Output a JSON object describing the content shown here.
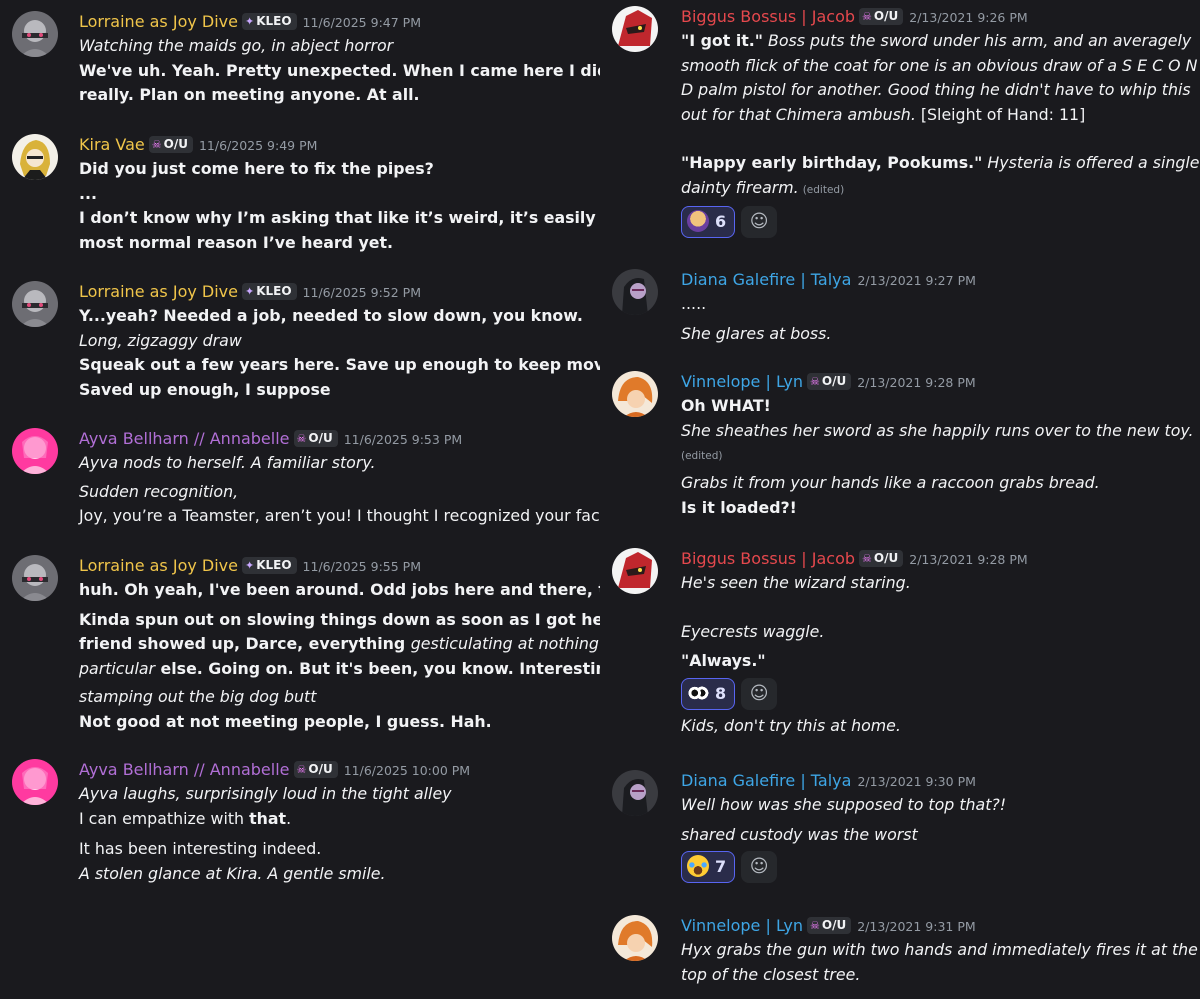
{
  "left": {
    "messages": [
      {
        "user": "Lorraine as Joy Dive",
        "color": "#f0c54a",
        "tag": "KLEO",
        "time": "11/6/2025 9:47 PM",
        "lines": [
          {
            "t": "Watching the maids go, in abject horror"
          },
          {
            "t": "We've uh. Yeah. Pretty unexpected. When I came here I didn't"
          },
          {
            "t": "really. Plan on meeting anyone. At all."
          }
        ]
      },
      {
        "user": "Kira Vae",
        "color": "#f0c54a",
        "tag": "O/U",
        "time": "11/6/2025 9:49 PM",
        "lines": [
          {
            "t": "Did you just come here to fix the pipes?"
          },
          {
            "t": "..."
          },
          {
            "t": "I don’t know why I’m asking that like it’s weird, it’s easily the"
          },
          {
            "t": "most normal reason I’ve heard yet."
          }
        ]
      },
      {
        "user": "Lorraine as Joy Dive",
        "color": "#f0c54a",
        "tag": "KLEO",
        "time": "11/6/2025 9:52 PM",
        "lines": [
          {
            "t": "Y...yeah? Needed a job, needed to slow down, you know."
          },
          {
            "t": "Long, zigzaggy draw"
          },
          {
            "t": "Squeak out a few years here. Save up enough to keep movin."
          },
          {
            "t": "Saved up enough, I suppose"
          }
        ]
      },
      {
        "user": "Ayva Bellharn // Annabelle",
        "color": "#b16fd6",
        "tag": "O/U",
        "time": "11/6/2025 9:53 PM",
        "lines": [
          {
            "t": "Ayva nods to herself. A familiar story."
          },
          {
            "t": "Sudden recognition,"
          },
          {
            "t": "Joy, you’re a Teamster, aren’t you! I thought I recognized your face."
          }
        ]
      },
      {
        "user": "Lorraine as Joy Dive",
        "color": "#f0c54a",
        "tag": "KLEO",
        "time": "11/6/2025 9:55 PM",
        "lines": [
          {
            "t": "huh. Oh yeah, I've been around. Odd jobs here and there, too"
          },
          {
            "t": "Kinda spun out on slowing things down as soon as I got here. Old"
          },
          {
            "t": "friend showed up, Darce, everything"
          },
          {
            "t": "gesticulating at nothing in"
          },
          {
            "t": "particular"
          },
          {
            "t": "else. Going on. But it's been, you know. Interesting"
          },
          {
            "t": "stamping out the big dog butt"
          },
          {
            "t": "Not good at not meeting people, I guess. Hah."
          }
        ]
      },
      {
        "user": "Ayva Bellharn // Annabelle",
        "color": "#b16fd6",
        "tag": "O/U",
        "time": "11/6/2025 10:00 PM",
        "lines": [
          {
            "t": "Ayva laughs, surprisingly loud in the tight alley"
          },
          {
            "t": "I can empathize with "
          },
          {
            "t": "that"
          },
          {
            "t": "."
          },
          {
            "t": "It has been interesting indeed."
          },
          {
            "t": "A stolen glance at Kira. A gentle smile."
          }
        ]
      }
    ]
  },
  "right": {
    "messages": [
      {
        "user": "Biggus Bossus | Jacob",
        "color": "#e5484d",
        "tag": "O/U",
        "time": "2/13/2021 9:26 PM",
        "lines": [
          {
            "t": "\"I got it.\""
          },
          {
            "t": " Boss puts the sword under his arm, and an averagely"
          },
          {
            "t": "smooth flick of the coat for one is an obvious draw of a S E C O N"
          },
          {
            "t": "D palm pistol for another. Good thing he didn't have to whip this"
          },
          {
            "t": "out for that Chimera ambush."
          },
          {
            "t": " [Sleight of Hand: 11]"
          },
          {
            "t": "\"Happy early birthday, Pookums.\""
          },
          {
            "t": " Hysteria is offered a single"
          },
          {
            "t": "dainty firearm."
          },
          {
            "t": "(edited)"
          }
        ],
        "reaction": {
          "emoji": "sunglasses-cowboy-emoji",
          "count": "6"
        }
      },
      {
        "user": "Diana Galefire | Talya",
        "color": "#3ea6e6",
        "tag": "",
        "time": "2/13/2021 9:27 PM",
        "lines": [
          {
            "t": "....."
          },
          {
            "t": "She glares at boss."
          }
        ]
      },
      {
        "user": "Vinnelope | Lyn",
        "color": "#3ea6e6",
        "tag": "O/U",
        "time": "2/13/2021 9:28 PM",
        "lines": [
          {
            "t": "Oh WHAT!"
          },
          {
            "t": "She sheathes her sword as she happily runs over to the new toy."
          },
          {
            "t": "(edited)"
          },
          {
            "t": "Grabs it from your hands like a raccoon grabs bread."
          },
          {
            "t": "Is it loaded?!"
          }
        ]
      },
      {
        "user": "Biggus Bossus | Jacob",
        "color": "#e5484d",
        "tag": "O/U",
        "time": "2/13/2021 9:28 PM",
        "lines": [
          {
            "t": "He's seen the wizard staring."
          },
          {
            "t": "Eyecrests waggle."
          },
          {
            "t": "\"Always.\""
          },
          {
            "t": "Kids, don't try this at home."
          }
        ],
        "reaction": {
          "emoji": "eyes-emoji",
          "count": "8"
        }
      },
      {
        "user": "Diana Galefire | Talya",
        "color": "#3ea6e6",
        "tag": "",
        "time": "2/13/2021 9:30 PM",
        "lines": [
          {
            "t": "Well how was she supposed to top that?!"
          },
          {
            "t": "shared custody was the worst"
          }
        ],
        "reaction": {
          "emoji": "joy-emoji",
          "count": "7"
        }
      },
      {
        "user": "Vinnelope | Lyn",
        "color": "#3ea6e6",
        "tag": "O/U",
        "time": "2/13/2021 9:31 PM",
        "lines": [
          {
            "t": "Hyx grabs the gun with two hands and immediately fires it at the"
          },
          {
            "t": "top of the closest tree."
          }
        ]
      }
    ]
  },
  "icons": {
    "skull": "skull-icon",
    "kleo": "flame-icon",
    "add_reaction": "smiley-icon"
  }
}
